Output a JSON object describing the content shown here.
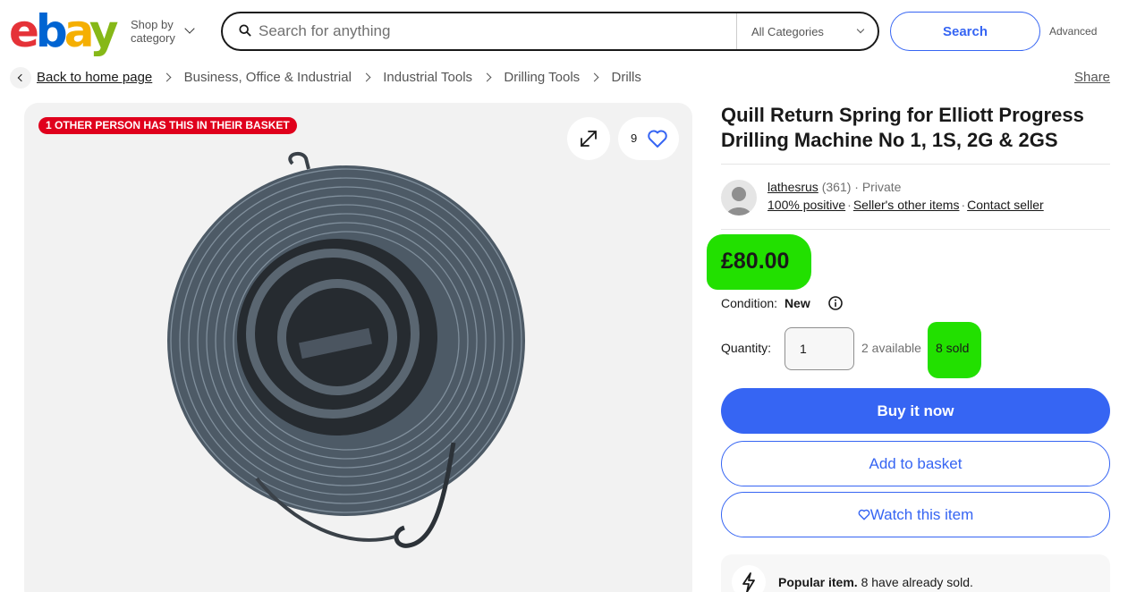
{
  "header": {
    "logo_letters": [
      "e",
      "b",
      "a",
      "y"
    ],
    "shop_by_line1": "Shop by",
    "shop_by_line2": "category",
    "search_placeholder": "Search for anything",
    "category_selected": "All Categories",
    "search_button": "Search",
    "advanced_link": "Advanced"
  },
  "breadcrumb": {
    "back_label": "Back to home page",
    "items": [
      "Business, Office & Industrial",
      "Industrial Tools",
      "Drilling Tools",
      "Drills"
    ],
    "share_label": "Share"
  },
  "gallery": {
    "badge": "1 OTHER PERSON HAS THIS IN THEIR BASKET",
    "watch_count": "9"
  },
  "listing": {
    "title": "Quill Return Spring for Elliott Progress Drilling Machine No 1, 1S, 2G & 2GS",
    "seller": {
      "name": "lathesrus",
      "feedback_count": "(361)",
      "seller_type": "Private",
      "positive": "100% positive",
      "other_items": "Seller's other items",
      "contact": "Contact seller"
    },
    "price": "£80.00",
    "condition_label": "Condition:",
    "condition_value": "New",
    "quantity_label": "Quantity:",
    "quantity_value": "1",
    "available": "2 available",
    "sold": "8 sold",
    "buy_now": "Buy it now",
    "add_to_basket": "Add to basket",
    "watch_item": "Watch this item",
    "popular_title": "Popular item.",
    "popular_text": "8 have already sold."
  },
  "colors": {
    "accent_blue": "#3665f3",
    "highlight_green": "#22e000",
    "badge_red": "#e0001c"
  },
  "icons": [
    "search-icon",
    "chevron-down-icon",
    "chevron-left-icon",
    "expand-icon",
    "heart-icon",
    "info-icon",
    "lightning-icon",
    "avatar-icon"
  ]
}
